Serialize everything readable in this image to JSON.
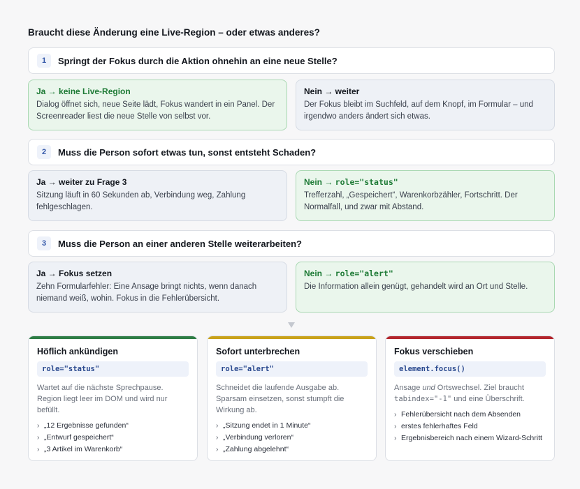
{
  "title": "Braucht diese Änderung eine Live-Region – oder etwas anderes?",
  "questions": [
    {
      "num": "1",
      "text": "Springt der Fokus durch die Aktion ohnehin an eine neue Stelle?",
      "yes": {
        "head": "Ja → keine Live-Region",
        "body": "Dialog öffnet sich, neue Seite lädt, Fokus wandert in ein Panel. Der Screenreader liest die neue Stelle von selbst vor."
      },
      "no": {
        "head": "Nein → weiter",
        "body": "Der Fokus bleibt im Suchfeld, auf dem Knopf, im Formular – und irgendwo anders ändert sich etwas."
      }
    },
    {
      "num": "2",
      "text": "Muss die Person sofort etwas tun, sonst entsteht Schaden?",
      "yes": {
        "head": "Ja → weiter zu Frage 3",
        "body": "Sitzung läuft in 60 Sekunden ab, Verbindung weg, Zahlung fehlgeschlagen."
      },
      "no": {
        "head_prefix": "Nein → ",
        "head_code": "role=\"status\"",
        "body": "Trefferzahl, „Gespeichert“, Warenkorbzähler, Fortschritt. Der Normalfall, und zwar mit Abstand."
      }
    },
    {
      "num": "3",
      "text": "Muss die Person an einer anderen Stelle weiterarbeiten?",
      "yes": {
        "head": "Ja → Fokus setzen",
        "body": "Zehn Formularfehler: Eine Ansage bringt nichts, wenn danach niemand weiß, wohin. Fokus in die Fehlerübersicht."
      },
      "no": {
        "head_prefix": "Nein → ",
        "head_code": "role=\"alert\"",
        "body": "Die Information allein genügt, gehandelt wird an Ort und Stelle."
      }
    }
  ],
  "cards": [
    {
      "color": "#2e7d45",
      "title": "Höflich ankündigen",
      "code": "role=\"status\"",
      "desc": "Wartet auf die nächste Sprechpause. Region liegt leer im DOM und wird nur befüllt.",
      "items": [
        "„12 Ergebnisse gefunden“",
        "„Entwurf gespeichert“",
        "„3 Artikel im Warenkorb“"
      ]
    },
    {
      "color": "#c9a21a",
      "title": "Sofort unterbrechen",
      "code": "role=\"alert\"",
      "desc": "Schneidet die laufende Ausgabe ab. Sparsam einsetzen, sonst stumpft die Wirkung ab.",
      "items": [
        "„Sitzung endet in 1 Minute“",
        "„Verbindung verloren“",
        "„Zahlung abgelehnt“"
      ]
    },
    {
      "color": "#b3262d",
      "title": "Fokus verschieben",
      "code": "element.focus()",
      "desc_a": "Ansage ",
      "desc_em": "und",
      "desc_b": " Ortswechsel. Ziel braucht ",
      "desc_code": "tabindex=\"-1\"",
      "desc_c": " und eine Überschrift.",
      "items": [
        "Fehlerübersicht nach dem Absenden",
        "erstes fehlerhaftes Feld",
        "Ergebnisbereich nach einem Wizard-Schritt"
      ]
    }
  ],
  "icons": {
    "arrow": "down-triangle-icon",
    "bullet": "chevron-right-icon"
  }
}
